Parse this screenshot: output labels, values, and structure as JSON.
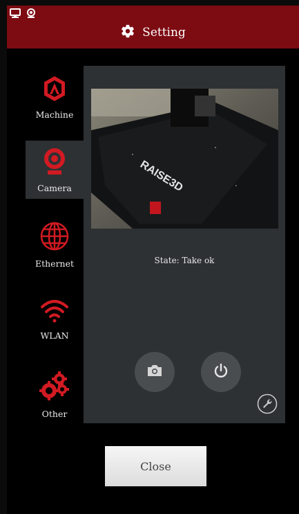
{
  "header": {
    "title": "Setting",
    "icons": [
      "monitor-icon",
      "webcam-icon",
      "gear-icon"
    ],
    "color": "#7d0b12"
  },
  "sidebar": {
    "items": [
      {
        "label": "Machine",
        "icon": "raise3d-logo-icon",
        "active": false
      },
      {
        "label": "Camera",
        "icon": "webcam-icon",
        "active": true
      },
      {
        "label": "Ethernet",
        "icon": "globe-icon",
        "active": false
      },
      {
        "label": "WLAN",
        "icon": "wifi-icon",
        "active": false
      },
      {
        "label": "Other",
        "icon": "gears-icon",
        "active": false
      }
    ],
    "icon_color": "#d11a22"
  },
  "camera_panel": {
    "state_text": "State: Take ok",
    "bed_brand": "RAISE3D",
    "actions": [
      "camera-icon",
      "power-icon",
      "wrench-icon"
    ]
  },
  "footer": {
    "close_label": "Close"
  }
}
